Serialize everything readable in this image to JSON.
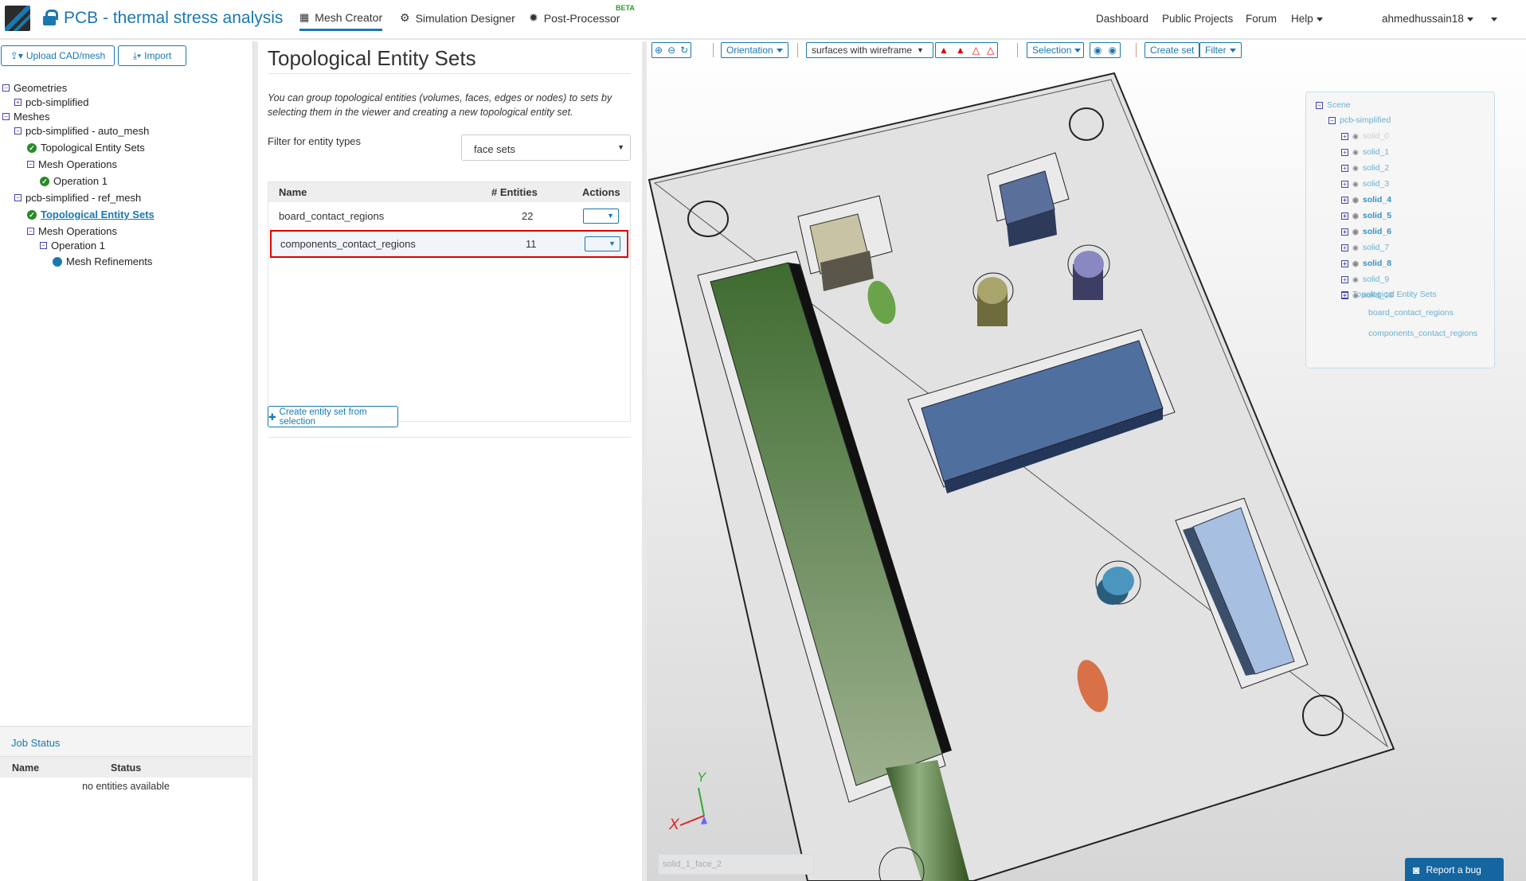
{
  "header": {
    "project_title": "PCB - thermal stress analysis",
    "tabs": [
      {
        "label": "Mesh Creator"
      },
      {
        "label": "Simulation Designer"
      },
      {
        "label": "Post-Processor",
        "badge": "BETA"
      }
    ],
    "right_nav": [
      "Dashboard",
      "Public Projects",
      "Forum",
      "Help"
    ],
    "user": "ahmedhussain18"
  },
  "left": {
    "upload_label": "Upload CAD/mesh",
    "import_label": "Import",
    "tree": [
      "Geometries",
      "pcb-simplified",
      "Meshes",
      "pcb-simplified - auto_mesh",
      "Topological Entity Sets",
      "Mesh Operations",
      "Operation 1",
      "pcb-simplified - ref_mesh",
      "Topological Entity Sets",
      "Mesh Operations",
      "Operation 1",
      "Mesh Refinements"
    ],
    "job_status": {
      "title": "Job Status",
      "columns": [
        "Name",
        "Status"
      ],
      "empty": "no entities available"
    }
  },
  "main": {
    "title": "Topological Entity Sets",
    "description": "You can group topological entities (volumes, faces, edges or nodes) to sets by selecting them in the viewer and creating a new topological entity set.",
    "filter_label": "Filter for entity types",
    "filter_value": "face sets",
    "table": {
      "columns": [
        "Name",
        "# Entities",
        "Actions"
      ],
      "rows": [
        {
          "name": "board_contact_regions",
          "count": "22"
        },
        {
          "name": "components_contact_regions",
          "count": "11"
        }
      ]
    },
    "create_label": "Create entity set from selection"
  },
  "viewer": {
    "toolbar": {
      "orientation": "Orientation",
      "render_mode": "surfaces with wireframe",
      "selection": "Selection",
      "create_set": "Create set",
      "filter": "Filter"
    },
    "scene_tree": {
      "root": "Scene",
      "model": "pcb-simplified",
      "solids": [
        "solid_0",
        "solid_1",
        "solid_2",
        "solid_3",
        "solid_4",
        "solid_5",
        "solid_6",
        "solid_7",
        "solid_8",
        "solid_9",
        "solid_10"
      ],
      "sets_label": "Topological Entity Sets",
      "sets": [
        "board_contact_regions",
        "components_contact_regions"
      ]
    },
    "axis": {
      "x": "X",
      "y": "Y"
    },
    "hover_field": "solid_1_face_2",
    "report_bug": "Report a bug",
    "colors": {
      "accent": "#1a78b0",
      "highlight": "#e00000"
    }
  }
}
